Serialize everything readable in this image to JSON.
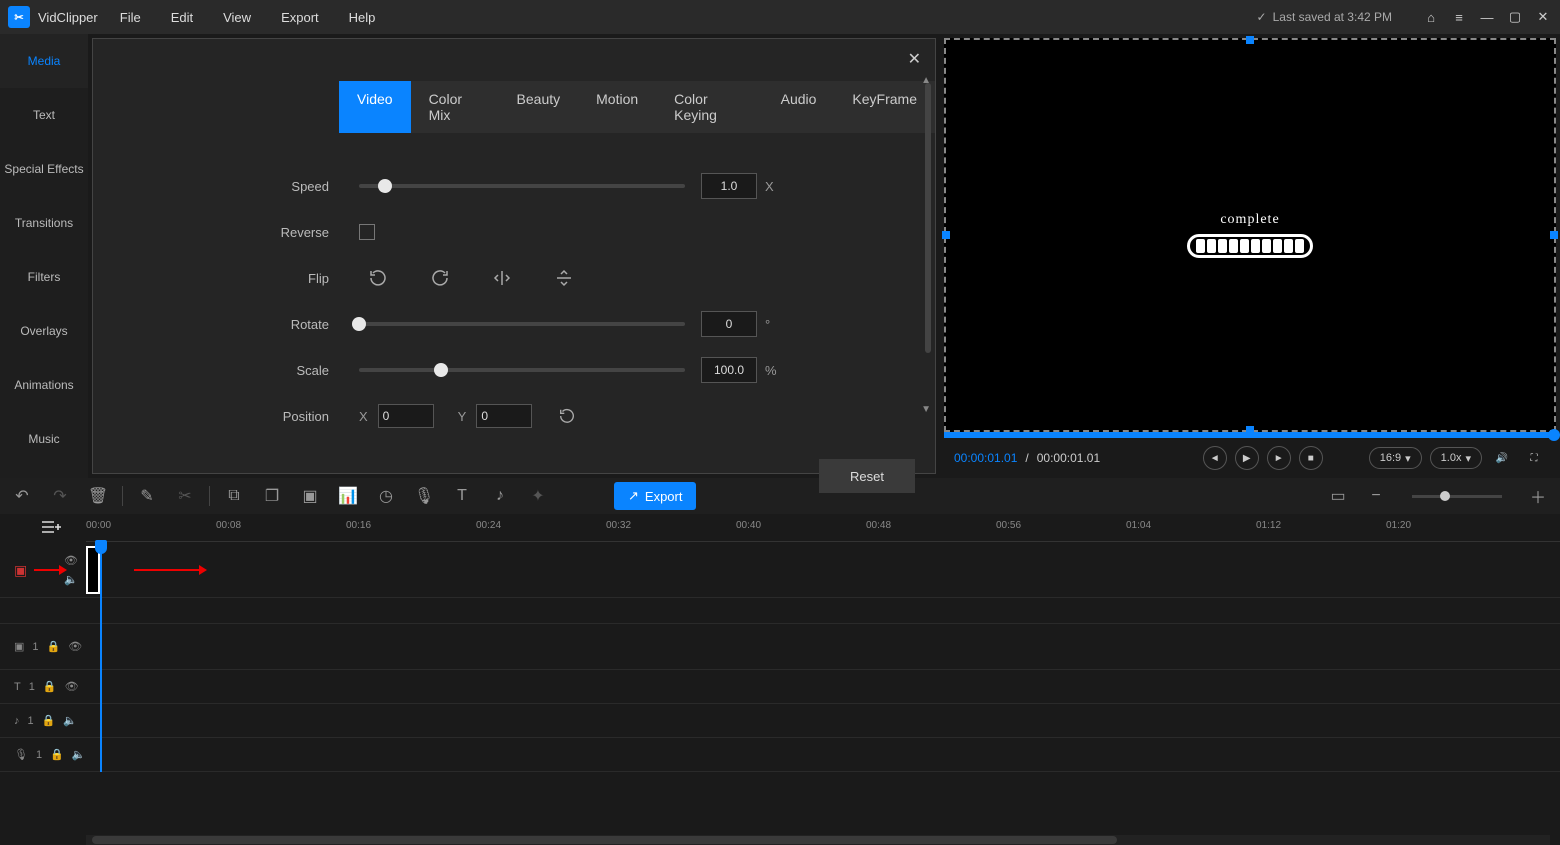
{
  "app": {
    "name": "VidClipper"
  },
  "menu": {
    "file": "File",
    "edit": "Edit",
    "view": "View",
    "export": "Export",
    "help": "Help"
  },
  "status": {
    "saved": "Last saved at 3:42 PM"
  },
  "sidebar": {
    "items": [
      "Media",
      "Text",
      "Special Effects",
      "Transitions",
      "Filters",
      "Overlays",
      "Animations",
      "Music"
    ]
  },
  "props": {
    "tabs": [
      "Video",
      "Color Mix",
      "Beauty",
      "Motion",
      "Color Keying",
      "Audio",
      "KeyFrame"
    ],
    "speed_label": "Speed",
    "speed_value": "1.0",
    "speed_suffix": "X",
    "reverse_label": "Reverse",
    "flip_label": "Flip",
    "rotate_label": "Rotate",
    "rotate_value": "0",
    "rotate_suffix": "°",
    "scale_label": "Scale",
    "scale_value": "100.0",
    "scale_suffix": "%",
    "position_label": "Position",
    "pos_x_label": "X",
    "pos_x_value": "0",
    "pos_y_label": "Y",
    "pos_y_value": "0",
    "reset": "Reset"
  },
  "preview": {
    "word": "complete",
    "time_current": "00:00:01.01",
    "time_total": "00:00:01.01",
    "aspect": "16:9",
    "playback_rate": "1.0x"
  },
  "toolbar": {
    "export": "Export"
  },
  "ruler": {
    "marks": [
      "00:00",
      "00:08",
      "00:16",
      "00:24",
      "00:32",
      "00:40",
      "00:48",
      "00:56",
      "01:04",
      "01:12",
      "01:20"
    ]
  },
  "tracks": {
    "t2_num": "1",
    "t3_num": "1",
    "t4_num": "1",
    "t5_num": "1"
  }
}
